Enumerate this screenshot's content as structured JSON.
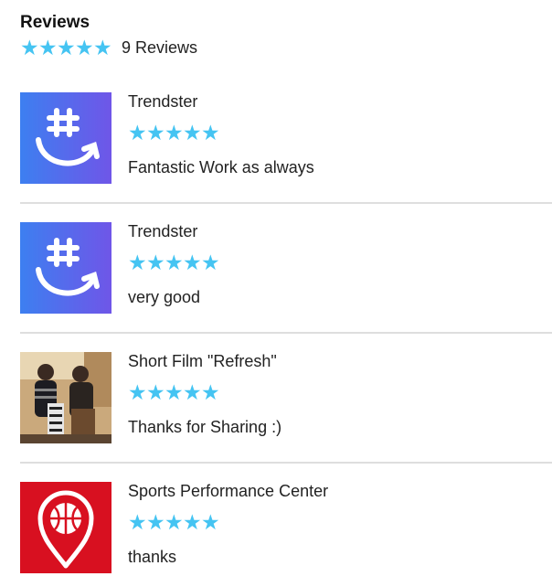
{
  "header": {
    "title": "Reviews",
    "rating_stars": 5,
    "count_label": "9 Reviews"
  },
  "reviews": [
    {
      "app_name": "Trendster",
      "stars": 5,
      "comment": "Fantastic Work as always",
      "thumb_icon": "hashtag-smile-icon"
    },
    {
      "app_name": "Trendster",
      "stars": 5,
      "comment": "very good",
      "thumb_icon": "hashtag-smile-icon"
    },
    {
      "app_name": "Short Film \"Refresh\"",
      "stars": 5,
      "comment": "Thanks for Sharing :)",
      "thumb_icon": "photo-thumbnail"
    },
    {
      "app_name": "Sports Performance Center",
      "stars": 5,
      "comment": "thanks",
      "thumb_icon": "basketball-pin-icon"
    }
  ],
  "colors": {
    "star": "#45c4f2",
    "divider": "#dedede",
    "trendster_gradient_start": "#3d7ff0",
    "trendster_gradient_end": "#6f56e8",
    "sports_red": "#d81020"
  }
}
